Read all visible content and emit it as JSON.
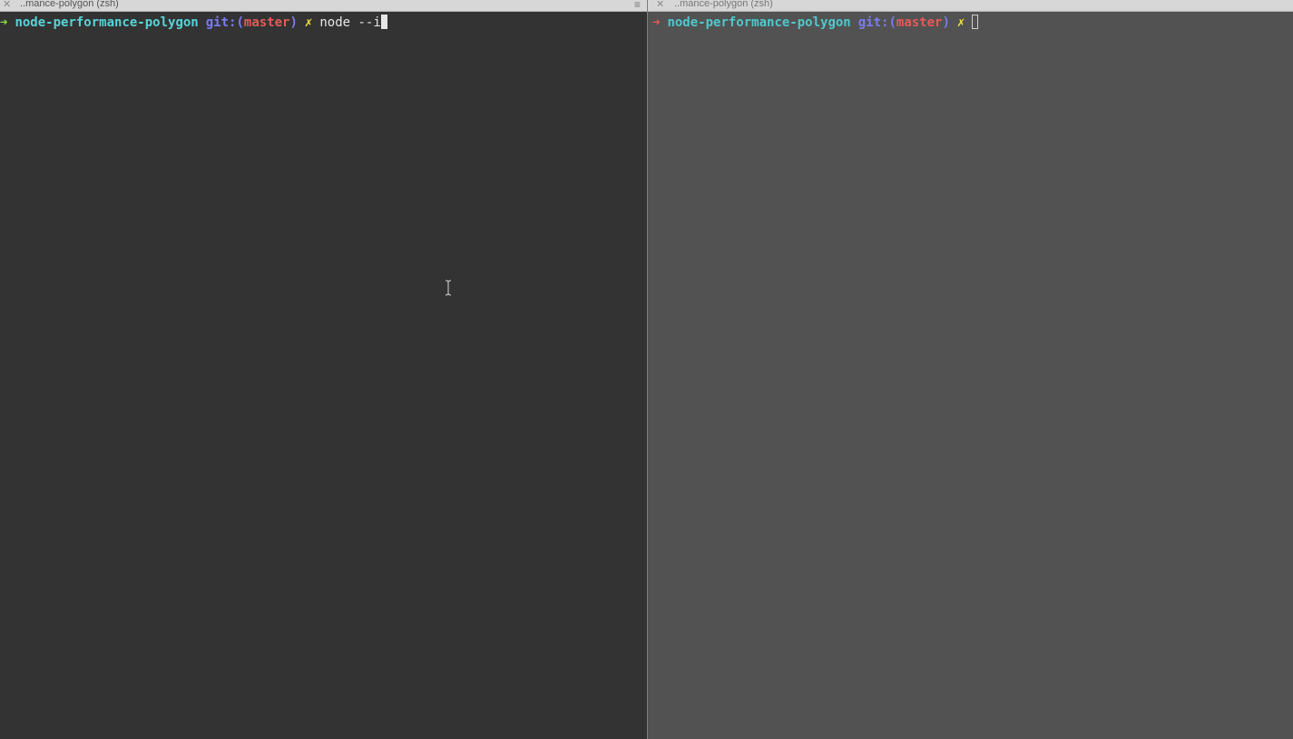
{
  "left_pane": {
    "tab_close": "✕",
    "tab_title": "..mance-polygon (zsh)",
    "tab_menu": "≡",
    "prompt": {
      "arrow": "➜",
      "directory": "node-performance-polygon",
      "git_label": "git:",
      "paren_open": "(",
      "branch": "master",
      "paren_close": ")",
      "dirty_mark": "✗"
    },
    "command": "node --i"
  },
  "right_pane": {
    "tab_close": "✕",
    "tab_title": "..mance-polygon (zsh)",
    "prompt": {
      "arrow": "➜",
      "directory": "node-performance-polygon",
      "git_label": "git:",
      "paren_open": "(",
      "branch": "master",
      "paren_close": ")",
      "dirty_mark": "✗"
    }
  },
  "colors": {
    "left_background": "#333334",
    "right_background": "#525252",
    "arrow_left": "#8ce14a",
    "arrow_right": "#e85d52",
    "directory": "#56d4d6",
    "git": "#7b7cf0",
    "branch": "#e65a58",
    "dirty": "#f2e442"
  }
}
